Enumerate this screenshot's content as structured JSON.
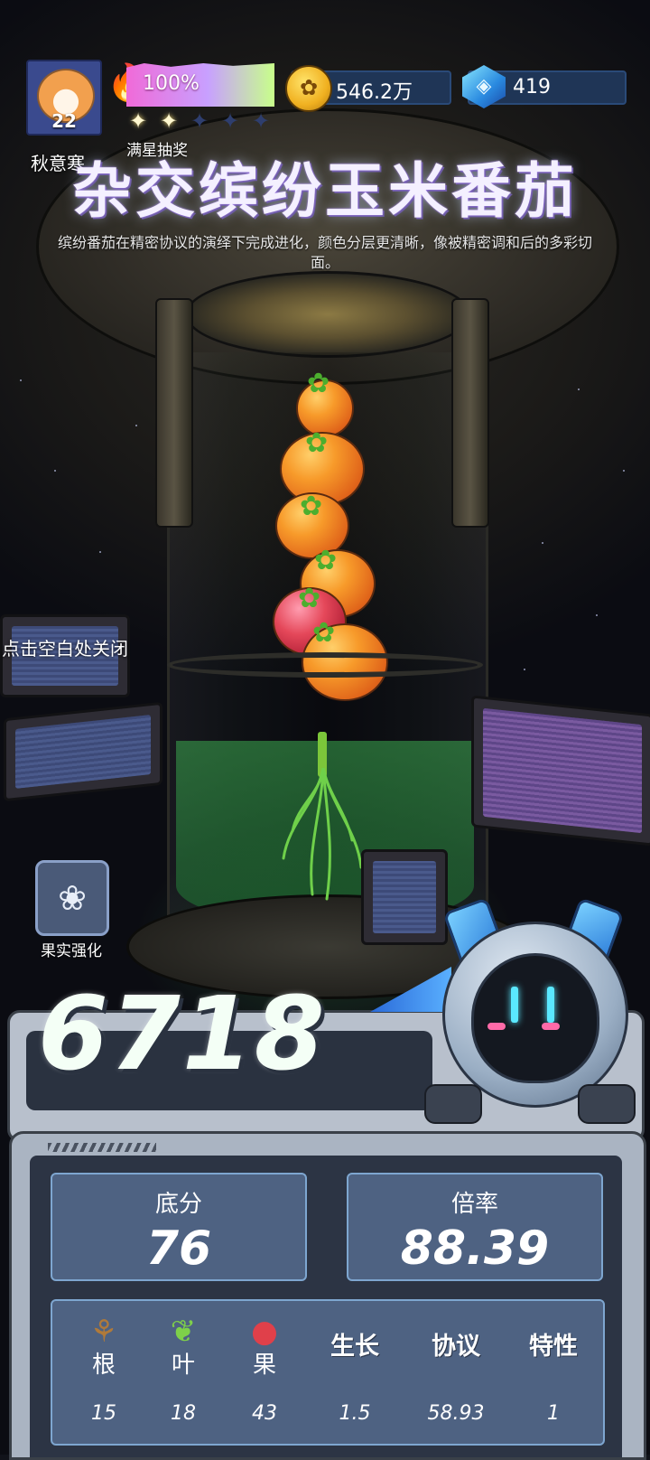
{
  "header": {
    "player_level": "22",
    "player_name": "秋意寒",
    "progress_text": "100%",
    "progress_value": 1.0,
    "stars_filled": 2,
    "stars_total": 5,
    "draw_label": "满星抽奖",
    "coins": "546.2万",
    "gems": "419"
  },
  "plant": {
    "title": "杂交缤纷玉米番茄",
    "description": "缤纷番茄在精密协议的演绎下完成进化，颜色分层更清晰，像被精密调和后的多彩切面。"
  },
  "hints": {
    "close": "点击空白处关闭"
  },
  "actions": {
    "fruit_boost_label": "果实强化"
  },
  "score": {
    "total": "6718",
    "base_label": "底分",
    "base_value": "76",
    "multiplier_label": "倍率",
    "multiplier_value": "88.39"
  },
  "attributes": [
    {
      "name": "根",
      "value": "15",
      "icon": "sprout-icon"
    },
    {
      "name": "叶",
      "value": "18",
      "icon": "leaf-icon"
    },
    {
      "name": "果",
      "value": "43",
      "icon": "fruit-icon"
    },
    {
      "name": "生长",
      "value": "1.5"
    },
    {
      "name": "协议",
      "value": "58.93"
    },
    {
      "name": "特性",
      "value": "1"
    }
  ]
}
